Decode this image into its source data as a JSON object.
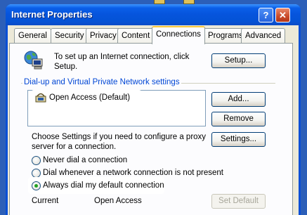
{
  "window": {
    "title": "Internet Properties",
    "help_glyph": "?",
    "close_glyph": "✕"
  },
  "tabs": [
    {
      "label": "General"
    },
    {
      "label": "Security"
    },
    {
      "label": "Privacy"
    },
    {
      "label": "Content"
    },
    {
      "label": "Connections",
      "active": true
    },
    {
      "label": "Programs"
    },
    {
      "label": "Advanced"
    }
  ],
  "setup": {
    "text_line1": "To set up an Internet connection, click",
    "text_line2": "Setup.",
    "button": "Setup..."
  },
  "dialup": {
    "group_label": "Dial-up and Virtual Private Network settings",
    "connections": [
      {
        "name": "Open Access (Default)",
        "icon": "dial-up-connection-icon"
      }
    ],
    "add_button": "Add...",
    "remove_button": "Remove",
    "settings_button": "Settings...",
    "settings_text_line1": "Choose Settings if you need to configure a proxy",
    "settings_text_line2": "server for a connection."
  },
  "dial_options": [
    {
      "label": "Never dial a connection",
      "checked": false
    },
    {
      "label": "Dial whenever a network connection is not present",
      "checked": false
    },
    {
      "label": "Always dial my default connection",
      "checked": true
    }
  ],
  "current": {
    "label": "Current",
    "value": "Open Access",
    "set_default_button": "Set Default"
  },
  "colors": {
    "title_bar": "#0654dc",
    "group_label": "#0046d5",
    "tab_highlight": "#ffc83c",
    "radio_dot": "#21a121"
  }
}
